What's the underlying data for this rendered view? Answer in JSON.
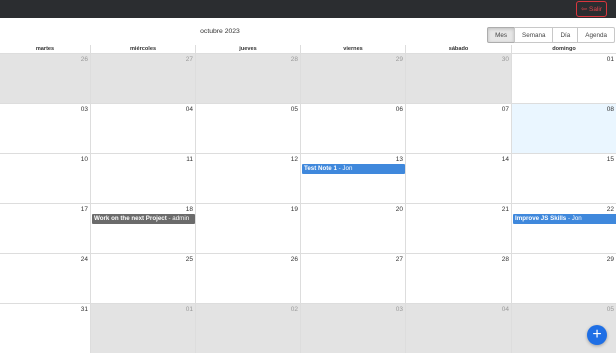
{
  "topbar": {
    "logout_label": "Salir",
    "logout_icon": "logout-icon"
  },
  "toolbar": {
    "month_label": "octubre 2023",
    "views": [
      "Mes",
      "Semana",
      "Día",
      "Agenda"
    ],
    "active_view": "Mes"
  },
  "calendar": {
    "weekdays": [
      "martes",
      "miércoles",
      "jueves",
      "viernes",
      "sábado",
      "domingo"
    ],
    "weeks": [
      [
        "26",
        "27",
        "28",
        "29",
        "30",
        "01"
      ],
      [
        "03",
        "04",
        "05",
        "06",
        "07",
        "08"
      ],
      [
        "10",
        "11",
        "12",
        "13",
        "14",
        "15"
      ],
      [
        "17",
        "18",
        "19",
        "20",
        "21",
        "22"
      ],
      [
        "24",
        "25",
        "26",
        "27",
        "28",
        "29"
      ],
      [
        "31",
        "01",
        "02",
        "03",
        "04",
        "05"
      ]
    ],
    "events": {
      "test_note": {
        "title": "Test Note 1",
        "sep": " - ",
        "user": "Jon"
      },
      "next_project": {
        "title": "Work on the next Project",
        "sep": " - ",
        "user": "admin"
      },
      "js_skills": {
        "title": "Improve JS Skills",
        "sep": " - ",
        "user": "Jon"
      }
    },
    "colors": {
      "event_blue": "#3f88dc",
      "event_gray": "#6b6b6b",
      "today": "#eaf6ff",
      "off_range": "#e3e3e3"
    }
  },
  "fab": {
    "label": "+",
    "icon": "plus-icon",
    "color": "#1f6fe5"
  }
}
